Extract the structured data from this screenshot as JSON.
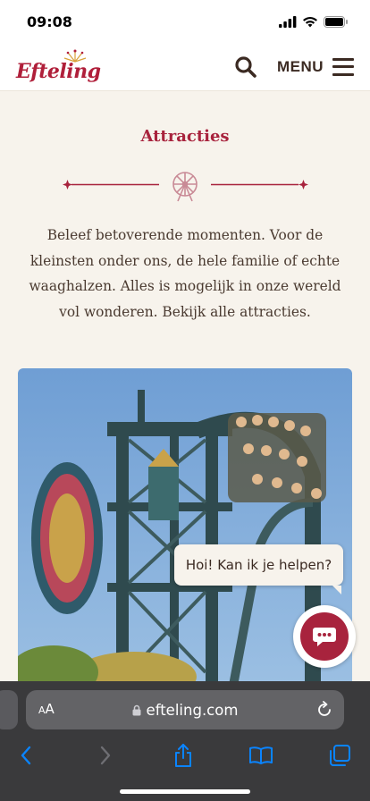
{
  "status_bar": {
    "time": "09:08"
  },
  "header": {
    "logo_text": "Efteling",
    "menu_label": "MENU"
  },
  "content": {
    "title": "Attracties",
    "intro": "Beleef betoverende momenten. Voor de kleinsten onder ons, de hele familie of echte waaghalzen. Alles is mogelijk in onze wereld vol wonderen. Bekijk alle attracties."
  },
  "chat": {
    "bubble_text": "Hoi! Kan ik je helpen?"
  },
  "browser": {
    "aa_small": "A",
    "aa_big": "A",
    "url": "efteling.com"
  },
  "colors": {
    "brand": "#a8233d",
    "background": "#f7f3ec",
    "text": "#3b2a22",
    "browser_bar": "#3a3a3c",
    "browser_accent": "#0a84ff"
  },
  "icons": {
    "search": "search-icon",
    "menu": "hamburger-icon",
    "divider": "ferris-wheel-icon",
    "chat": "chat-bubble-icon",
    "lock": "lock-icon",
    "reload": "reload-icon",
    "back": "chevron-left-icon",
    "forward": "chevron-right-icon",
    "share": "share-icon",
    "bookmarks": "book-icon",
    "tabs": "tabs-icon"
  }
}
